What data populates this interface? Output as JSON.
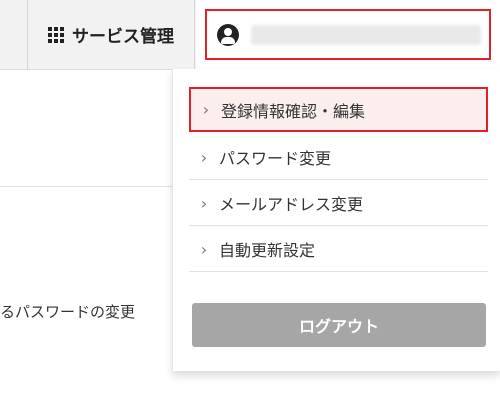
{
  "header": {
    "service_label": "サービス管理",
    "user_name": "••••••••••••••••••••"
  },
  "background": {
    "partial_text": "るパスワードの変更"
  },
  "dropdown": {
    "items": [
      {
        "label": "登録情報確認・編集"
      },
      {
        "label": "パスワード変更"
      },
      {
        "label": "メールアドレス変更"
      },
      {
        "label": "自動更新設定"
      }
    ],
    "logout_label": "ログアウト"
  },
  "colors": {
    "highlight_border": "#e2202a",
    "highlight_fill": "#fdeeee",
    "logout_bg": "#a6a6a6"
  },
  "icons": [
    "grid-icon",
    "user-icon",
    "chevron-right-icon"
  ]
}
